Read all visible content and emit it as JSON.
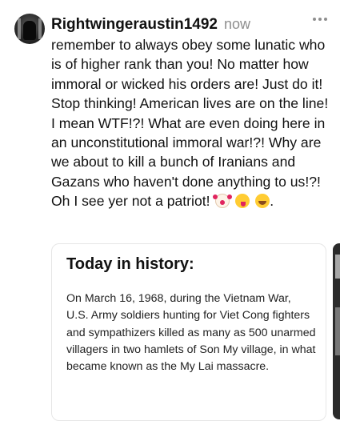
{
  "post": {
    "username": "Rightwingeraustin1492",
    "timestamp": "now",
    "text": "remember to always obey some lunatic who is of higher rank than you! No matter how immoral or wicked his orders are! Just do it! Stop thinking! American lives are on the line! I mean WTF!?! What are even doing here in an unconstitutional immoral war!?! Why are we about to kill a bunch of Iranians and Gazans who haven't done anything to us!?! Oh I see yer not a patriot!",
    "text_end": ".",
    "emojis": [
      "clown-face",
      "winking-face-with-tongue",
      "face-with-tears-of-joy"
    ]
  },
  "card": {
    "title": "Today in history:",
    "text": "On March 16, 1968, during the Vietnam War, U.S. Army soldiers hunting for Viet Cong fighters and sympathizers killed as many as 500 unarmed villagers in two hamlets of Son My village, in what became known as the My Lai massacre."
  },
  "icons": {
    "avatar": "profile-avatar",
    "more": "more-horizontal-icon"
  },
  "colors": {
    "text": "#111111",
    "muted": "#8e8e8e",
    "card_border": "#e6e6e6"
  }
}
